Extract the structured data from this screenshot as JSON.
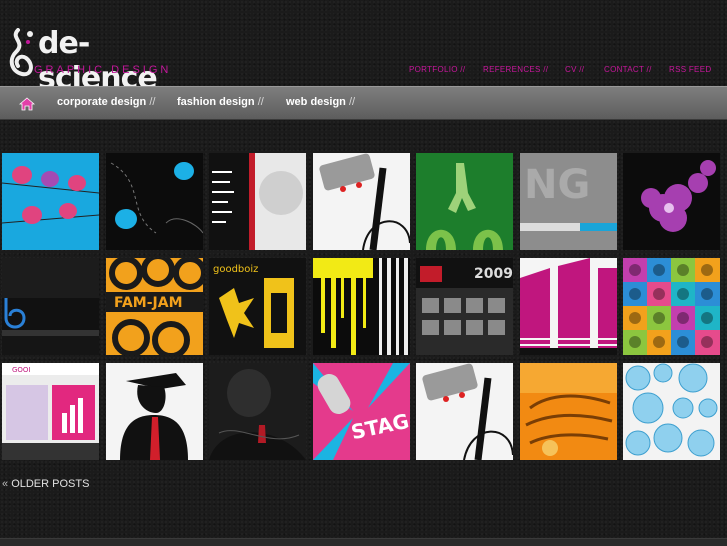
{
  "logo": {
    "name": "de-science",
    "tagline": "GRAPHIC DESIGN",
    "icon": "de-science-logo-icon"
  },
  "topnav": [
    {
      "label": "PORTFOLIO //"
    },
    {
      "label": "REFERENCES //"
    },
    {
      "label": "CV //"
    },
    {
      "label": "CONTACT //"
    },
    {
      "label": "RSS FEED"
    }
  ],
  "categories": [
    {
      "label": "corporate design",
      "sep": "//"
    },
    {
      "label": "fashion design",
      "sep": "//"
    },
    {
      "label": "web design",
      "sep": "//"
    }
  ],
  "home_icon": "home-icon",
  "thumbnails": [
    {
      "name": "birds-on-wire-cyan"
    },
    {
      "name": "blue-bird-black"
    },
    {
      "name": "menu-brochure"
    },
    {
      "name": "robot-cable"
    },
    {
      "name": "green-figure"
    },
    {
      "name": "grey-typography"
    },
    {
      "name": "purple-flowers"
    },
    {
      "name": "dark-website-blue"
    },
    {
      "name": "fam-jam-poster"
    },
    {
      "name": "goodboiz-yellow"
    },
    {
      "name": "yellow-drips"
    },
    {
      "name": "2009-calendar"
    },
    {
      "name": "pink-stripes-letter"
    },
    {
      "name": "portrait-grid"
    },
    {
      "name": "pink-boxes-website"
    },
    {
      "name": "hat-man-red-tie"
    },
    {
      "name": "dark-portrait-tie"
    },
    {
      "name": "microphone-stage"
    },
    {
      "name": "robot-cable-2"
    },
    {
      "name": "orange-type-poster"
    },
    {
      "name": "blue-bubbles"
    }
  ],
  "pager": {
    "laquo": "«",
    "label": "OLDER POSTS"
  },
  "colors": {
    "accent": "#c8169c",
    "bar": "#6e6e6e"
  }
}
